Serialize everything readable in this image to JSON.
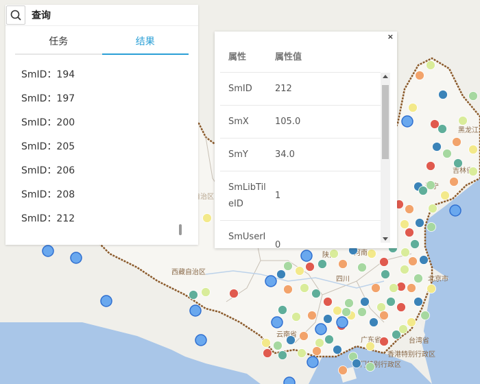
{
  "query_panel": {
    "title": "查询",
    "tabs": [
      {
        "label": "任务",
        "active": false
      },
      {
        "label": "结果",
        "active": true
      }
    ],
    "results": [
      "SmID：194",
      "SmID：197",
      "SmID：200",
      "SmID：205",
      "SmID：206",
      "SmID：208",
      "SmID：212"
    ]
  },
  "attr_panel": {
    "close_label": "×",
    "header": {
      "attr": "属性",
      "value": "属性值"
    },
    "rows": [
      {
        "attr": "SmID",
        "value": "212"
      },
      {
        "attr": "SmX",
        "value": "105.0"
      },
      {
        "attr": "SmY",
        "value": "34.0"
      },
      {
        "attr": "SmLibTil\neID",
        "value": "1"
      },
      {
        "attr": "SmUserI",
        "value": "0"
      }
    ]
  },
  "map_labels": [
    "新疆维吾尔自治区",
    "西藏自治区",
    "黑龙江",
    "吉林省",
    "辽宁",
    "北京市",
    "河南省",
    "陕西",
    "四川",
    "云南省",
    "广东省",
    "台湾省",
    "香港特别行政区",
    "澳门特别行政区"
  ],
  "colors": {
    "accent": "#2a9fd6",
    "water": "#a9c6e8",
    "land": "#f2f1ec"
  }
}
